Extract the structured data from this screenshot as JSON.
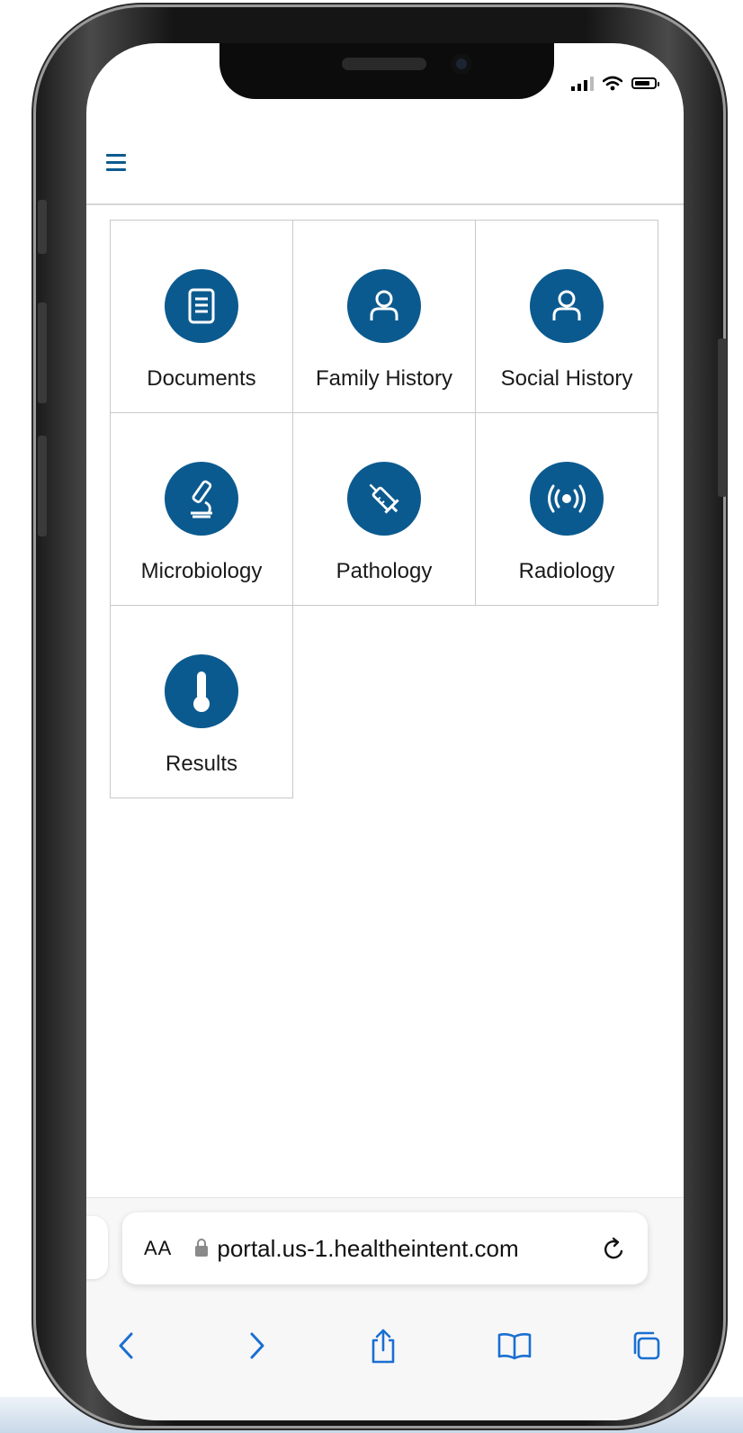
{
  "colors": {
    "accent": "#0b5a8f",
    "tile_border": "#c9c9c9",
    "toolbar_icon": "#1a6fd1"
  },
  "app": {
    "menu_icon": "hamburger-menu-icon",
    "tiles": [
      {
        "label": "Documents",
        "icon": "document-icon"
      },
      {
        "label": "Family History",
        "icon": "person-icon"
      },
      {
        "label": "Social History",
        "icon": "person-icon"
      },
      {
        "label": "Microbiology",
        "icon": "microscope-icon"
      },
      {
        "label": "Pathology",
        "icon": "syringe-icon"
      },
      {
        "label": "Radiology",
        "icon": "radiation-signal-icon"
      },
      {
        "label": "Results",
        "icon": "thermometer-icon"
      }
    ]
  },
  "safari": {
    "text_size_label": "AA",
    "url": "portal.us-1.healtheintent.com",
    "toolbar_icons": [
      "back-icon",
      "forward-icon",
      "share-icon",
      "bookmarks-icon",
      "tabs-icon"
    ]
  }
}
